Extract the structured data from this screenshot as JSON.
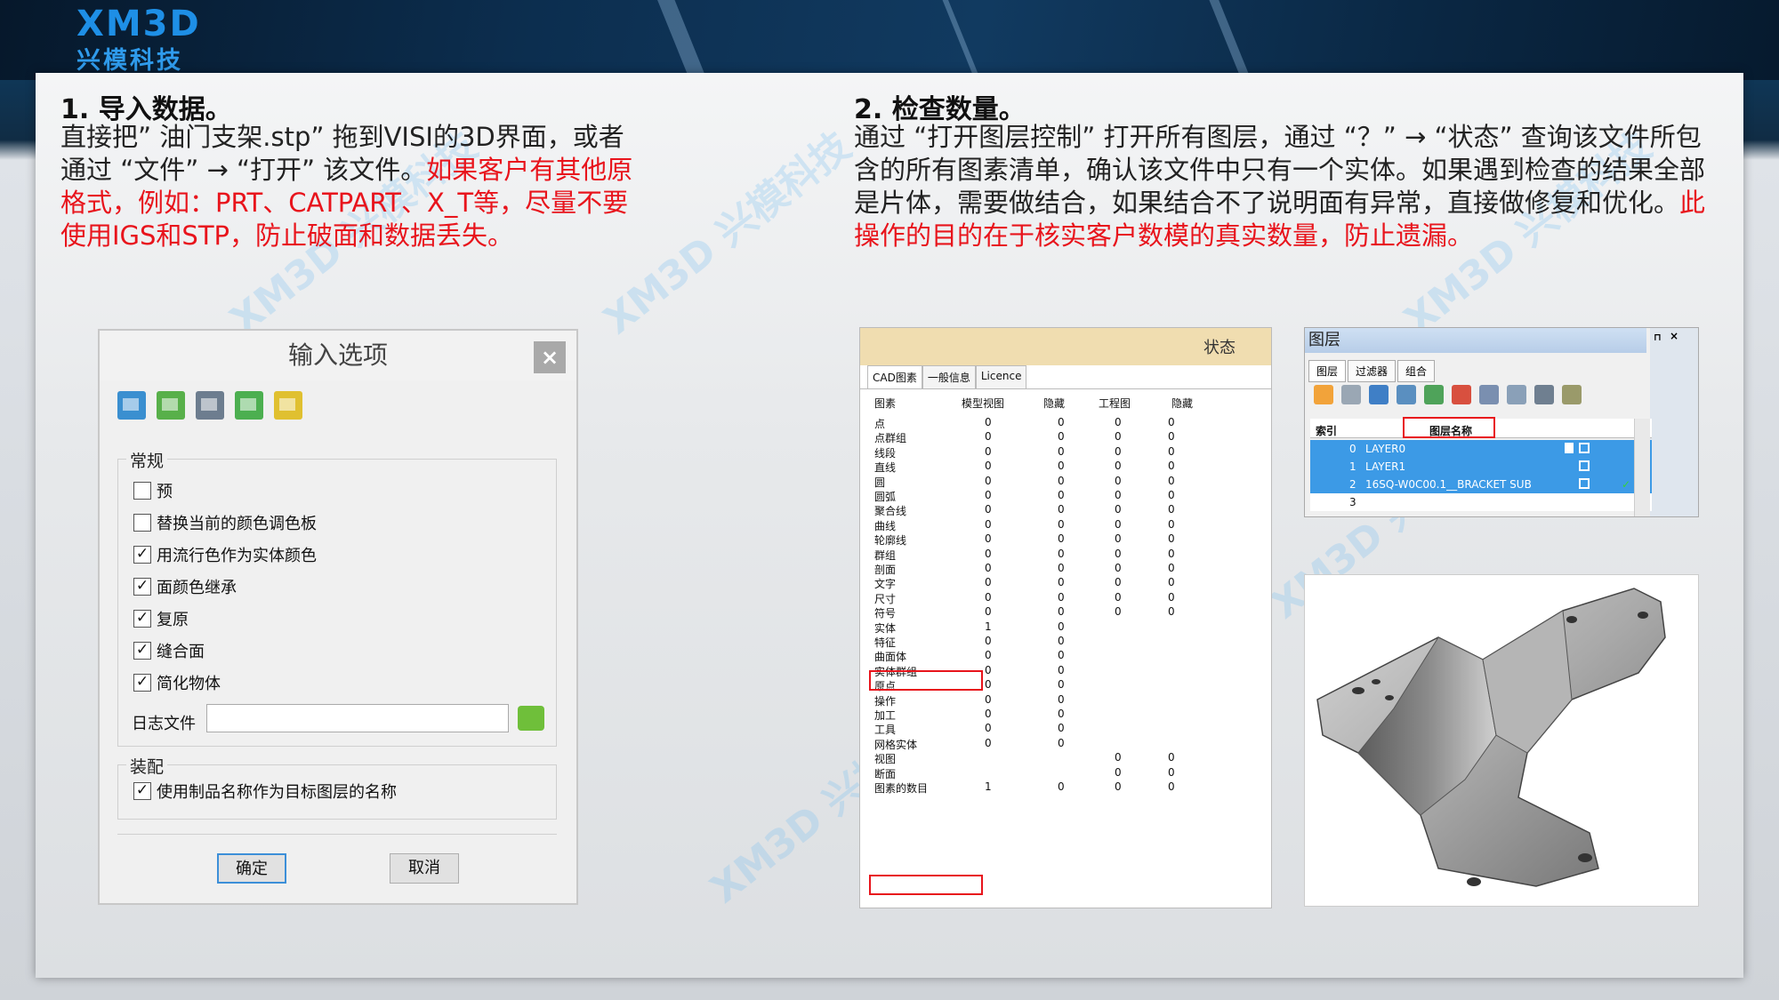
{
  "brand": {
    "name_en": "XM3D",
    "name_cn": "兴模科技"
  },
  "watermark": "XM3D 兴模科技",
  "step1": {
    "heading": "1. 导入数据。",
    "text": "直接把” 油门支架.stp” 拖到VISI的3D界面，或者通过 “文件” → “打开” 该文件。",
    "text_red": "如果客户有其他原格式，例如：PRT、CATPART、X_T等，尽量不要使用IGS和STP，防止破面和数据丢失。"
  },
  "step2": {
    "heading": "2. 检查数量。",
    "text": "通过 “打开图层控制” 打开所有图层，通过 “？” → “状态” 查询该文件所包含的所有图素清单，确认该文件中只有一个实体。如果遇到检查的结果全部是片体，需要做结合，如果结合不了说明面有异常，直接做修复和优化。",
    "text_red": "此操作的目的在于核实客户数模的真实数量，防止遗漏。"
  },
  "import_dialog": {
    "title": "输入选项",
    "close": "×",
    "general_label": "常规",
    "options": [
      {
        "label": "预",
        "checked": false
      },
      {
        "label": "替换当前的颜色调色板",
        "checked": false
      },
      {
        "label": "用流行色作为实体颜色",
        "checked": true
      },
      {
        "label": "面颜色继承",
        "checked": true
      },
      {
        "label": "复原",
        "checked": true
      },
      {
        "label": "缝合面",
        "checked": true
      },
      {
        "label": "简化物体",
        "checked": true
      }
    ],
    "log_label": "日志文件",
    "log_value": "",
    "assembly_label": "装配",
    "assembly_option": {
      "label": "使用制品名称作为目标图层的名称",
      "checked": true
    },
    "ok": "确定",
    "cancel": "取消",
    "check_glyph": "✓"
  },
  "status_window": {
    "title": "状态",
    "tabs": [
      "CAD图素",
      "一般信息",
      "Licence"
    ],
    "headers": [
      "图素",
      "模型视图",
      "隐藏",
      "工程图",
      "隐藏"
    ],
    "rows": [
      [
        "点",
        "0",
        "0",
        "0",
        "0"
      ],
      [
        "点群组",
        "0",
        "0",
        "0",
        "0"
      ],
      [
        "线段",
        "0",
        "0",
        "0",
        "0"
      ],
      [
        "直线",
        "0",
        "0",
        "0",
        "0"
      ],
      [
        "圆",
        "0",
        "0",
        "0",
        "0"
      ],
      [
        "圆弧",
        "0",
        "0",
        "0",
        "0"
      ],
      [
        "聚合线",
        "0",
        "0",
        "0",
        "0"
      ],
      [
        "曲线",
        "0",
        "0",
        "0",
        "0"
      ],
      [
        "轮廓线",
        "0",
        "0",
        "0",
        "0"
      ],
      [
        "群组",
        "0",
        "0",
        "0",
        "0"
      ],
      [
        "剖面",
        "0",
        "0",
        "0",
        "0"
      ],
      [
        "文字",
        "0",
        "0",
        "0",
        "0"
      ],
      [
        "尺寸",
        "0",
        "0",
        "0",
        "0"
      ],
      [
        "符号",
        "0",
        "0",
        "0",
        "0"
      ],
      [
        "实体",
        "1",
        "0",
        "",
        ""
      ],
      [
        "特征",
        "0",
        "0",
        "",
        ""
      ],
      [
        "曲面体",
        "0",
        "0",
        "",
        ""
      ],
      [
        "实体群组",
        "0",
        "0",
        "",
        ""
      ],
      [
        "原点",
        "0",
        "0",
        "",
        ""
      ],
      [
        "操作",
        "0",
        "0",
        "",
        ""
      ],
      [
        "加工",
        "0",
        "0",
        "",
        ""
      ],
      [
        "工具",
        "0",
        "0",
        "",
        ""
      ],
      [
        "网格实体",
        "0",
        "0",
        "",
        ""
      ],
      [
        "视图",
        "",
        "",
        "0",
        "0"
      ],
      [
        "断面",
        "",
        "",
        "0",
        "0"
      ],
      [
        "图素的数目",
        "1",
        "0",
        "0",
        "0"
      ]
    ]
  },
  "layer_window": {
    "title": "图层",
    "tabs": [
      "图层",
      "过滤器",
      "组合"
    ],
    "col_index": "索引",
    "col_name": "图层名称",
    "rows": [
      {
        "index": "0",
        "name": "LAYER0"
      },
      {
        "index": "1",
        "name": "LAYER1"
      },
      {
        "index": "2",
        "name": "16SQ-W0C00.1__BRACKET SUB"
      },
      {
        "index": "3",
        "name": ""
      }
    ]
  }
}
